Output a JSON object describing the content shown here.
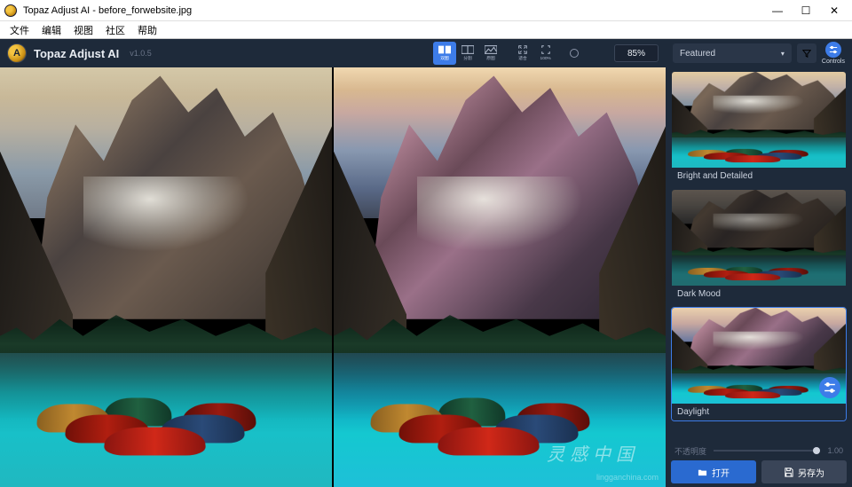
{
  "window": {
    "title": "Topaz Adjust AI - before_forwebsite.jpg",
    "min": "—",
    "max": "☐",
    "close": "✕"
  },
  "menu": {
    "file": "文件",
    "edit": "编辑",
    "view": "视图",
    "community": "社区",
    "help": "帮助"
  },
  "brand": {
    "title": "Topaz Adjust AI",
    "version": "v1.0.5",
    "logo_letter": "A"
  },
  "viewtools": {
    "dual": "双图",
    "split": "分割",
    "original": "原图",
    "fit": "适合",
    "hundred": "100%",
    "zoom_value": "85%"
  },
  "panel": {
    "featured": "Featured",
    "controls_label": "Controls",
    "presets": [
      {
        "label": "Bright and Detailed"
      },
      {
        "label": "Dark Mood"
      },
      {
        "label": "Daylight"
      }
    ],
    "opacity_label": "不透明度",
    "opacity_value": "1.00"
  },
  "actions": {
    "open": "打开",
    "saveas": "另存为"
  },
  "watermark": {
    "cn": "灵感中国",
    "url": "lingganchina.com"
  }
}
